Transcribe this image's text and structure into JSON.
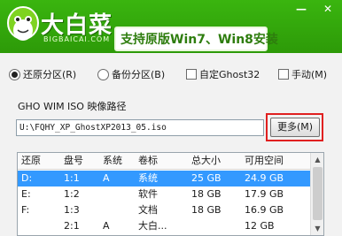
{
  "header": {
    "brand": "大白菜",
    "brand_sub": "BIGBAICAI.COM",
    "slogan": "支持原版Win7、Win8安装",
    "minimize": "—",
    "close": "✕",
    "brand_color": "#3ab50f"
  },
  "options": {
    "restore": "还原分区(R)",
    "backup": "备份分区(B)",
    "ghost32": "自定Ghost32",
    "manual": "手动(M)",
    "restore_selected": true
  },
  "path": {
    "label": "GHO WIM ISO 映像路径",
    "value": "U:\\FQHY_XP_GhostXP2013_05.iso",
    "more_button": "更多(M)"
  },
  "table": {
    "columns": [
      "还原",
      "盘号",
      "系统",
      "卷标",
      "总大小",
      "可用空间"
    ],
    "rows": [
      [
        "D:",
        "1:1",
        "A",
        "系统",
        "25 GB",
        "24.9 GB"
      ],
      [
        "E:",
        "1:2",
        "",
        "软件",
        "18 GB",
        "17.9 GB"
      ],
      [
        "F:",
        "1:3",
        "",
        "文档",
        "18 GB",
        "16.9 GB"
      ],
      [
        "",
        "2:1",
        "A",
        "大白...",
        "",
        "12 GB"
      ]
    ],
    "selected_row": 0,
    "select_color": "#3399ff"
  }
}
